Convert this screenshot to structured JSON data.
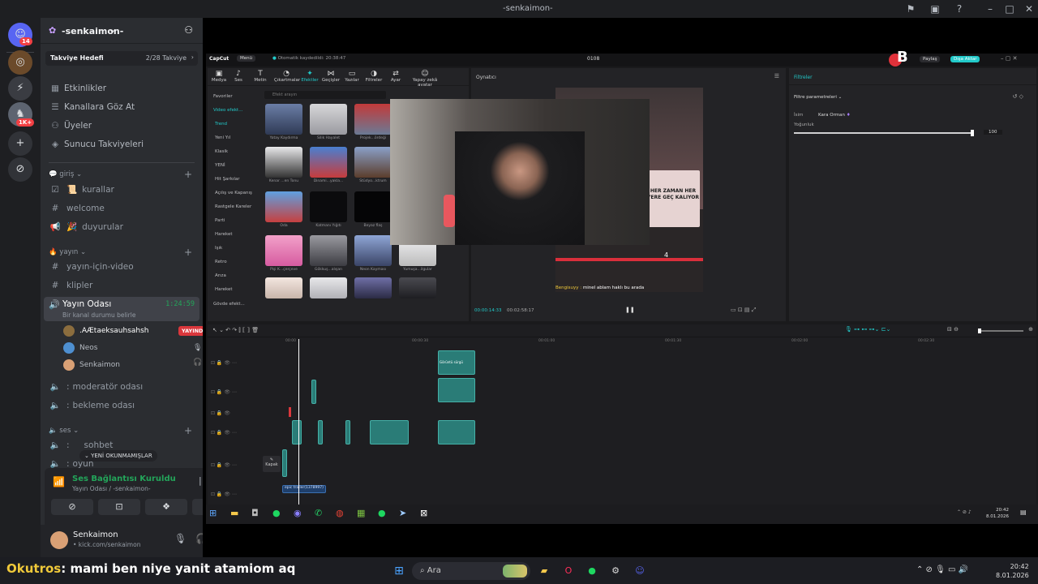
{
  "window": {
    "title": "-senkaimon-"
  },
  "rail": {
    "dm_badge": "14",
    "server_badge": "1K+"
  },
  "server": {
    "name": "-senkaimon-",
    "boost_label": "Takviye Hedefi",
    "boost_count": "2/28 Takviye",
    "nav": [
      "Etkinlikler",
      "Kanallara Göz At",
      "Üyeler",
      "Sunucu Takviyeleri"
    ]
  },
  "categories": {
    "giris": "giriş",
    "yayin": "yayın",
    "ses": "ses"
  },
  "channels": {
    "kurallar": "kurallar",
    "welcome": "welcome",
    "duyurular": "duyurular",
    "yayin_icin_video": "yayın-için-video",
    "klipler": "klipler",
    "yayin_odasi": "Yayın Odası",
    "yayin_timer": "1:24:59",
    "yayin_status": "Bir kanal durumu belirle",
    "moderator": "moderatör odası",
    "bekleme": "bekleme odası",
    "sohbet": "sohbet",
    "oyun": "oyun"
  },
  "voice_users": [
    {
      "name": ".AÆtaeksauhsahsh",
      "badge": "YAYINDA"
    },
    {
      "name": "Neos"
    },
    {
      "name": "Senkaimon"
    }
  ],
  "unread_pill": "YENİ OKUNMAMIŞLAR",
  "voice": {
    "status": "Ses Bağlantısı Kuruldu",
    "channel": "Yayın Odası / -senkaimon-"
  },
  "user": {
    "name": "Senkaimon",
    "status": "• kick.com/senkaimon"
  },
  "capcut": {
    "app_name": "CapCut",
    "menu": "Menü",
    "autosave": "Otomatik kaydedildi: 20:38:47",
    "project": "0108",
    "share": "Paylaş",
    "export": "Dışa Aktar",
    "tools": [
      "Medya",
      "Ses",
      "Metin",
      "Çıkartmalar",
      "Efektler",
      "Geçişler",
      "Yazılar",
      "Filtreler",
      "Ayar",
      "Yapay zekâ avatar"
    ],
    "search_placeholder": "Efekt arayın",
    "lib_categories": [
      "Favoriler",
      "Video efekt...",
      "Trend",
      "Yeni Yıl",
      "Klasik",
      "YENİ",
      "Hit Şarkılar",
      "Açılış ve Kapanış",
      "Rastgele Kareler",
      "Parti",
      "Hareket",
      "Işık",
      "Retro",
      "Arıza",
      "Hareket",
      "Gövde efekt..."
    ],
    "thumb_captions": [
      "Yatay Kaydırma",
      "Silik Hayalet",
      "Projek...ördeği",
      "Kenar ...en Tonu",
      "Dinami...yakla...",
      "Stüdyo...ktrum",
      "Oda",
      "Katmanı Yığıtı",
      "Beyaz flaş",
      "Pişi K...çerçeve",
      "Gökkuş...alışan",
      "Neon Kayması",
      "Yumuşa...ilgular"
    ],
    "player_label": "Oynatıcı",
    "time_current": "00:00:14:33",
    "time_total": "00:02:58:17",
    "overlay_text": "HER ZAMAN HER YERE GEÇ KALIYOR",
    "overlay_number": "4",
    "chat_user": "Bengisuyy :",
    "chat_msg": "minel ablam haklı bu arada",
    "filters_tab": "Filtreler",
    "filter_params": "Filtre parametreleri",
    "filter_name_label": "İsim",
    "filter_name": "Kara Orman",
    "intensity_label": "Yoğunluk",
    "intensity_value": "100",
    "timeline_ticks": [
      "00:00",
      "00:00:30",
      "00:01:00",
      "00:01:30",
      "00:02:00",
      "00:02:30"
    ],
    "cover_label": "Kapak",
    "audio_clip": "epic trailer(1378997)",
    "clip_top": "Görüntü sürgü",
    "inner_clock": "20:42",
    "inner_date": "8.01.2026"
  },
  "stream_chat": {
    "user": "Okutros",
    "message": ": mami ben niye yanit atamiom aq"
  },
  "taskbar": {
    "search": "Ara",
    "time": "20:42",
    "date": "8.01.2026"
  },
  "colors": {
    "discord_bg": "#2b2d31",
    "live_red": "#da373c",
    "voice_green": "#23a55a",
    "capcut_accent": "#22c9c9",
    "chat_yellow": "#f0c93a"
  }
}
